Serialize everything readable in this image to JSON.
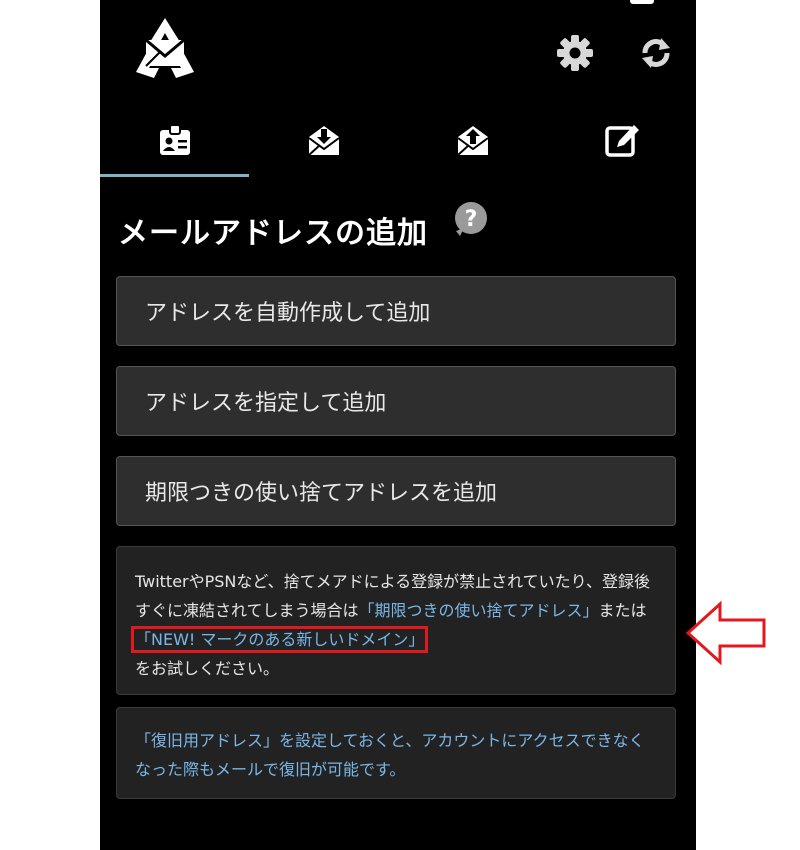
{
  "colors": {
    "background": "#000000",
    "button_bg": "#2e2e2e",
    "card_bg": "#222222",
    "link": "#7ab6e8",
    "tab_indicator": "#7fb4c2",
    "highlight": "#e0191f"
  },
  "header": {
    "logo_icon": "recycle-mail-logo",
    "icons": [
      "gear-icon",
      "refresh-icon"
    ]
  },
  "tabs": [
    {
      "icon": "contact-card-icon",
      "active": true
    },
    {
      "icon": "inbox-download-icon",
      "active": false
    },
    {
      "icon": "outbox-upload-icon",
      "active": false
    },
    {
      "icon": "compose-icon",
      "active": false
    }
  ],
  "page": {
    "title": "メールアドレスの追加"
  },
  "buttons": {
    "auto": "アドレスを自動作成して追加",
    "specify": "アドレスを指定して追加",
    "disposable": "期限つきの使い捨てアドレスを追加"
  },
  "notice": {
    "text1": "TwitterやPSNなど、捨てメアドによる登録が禁止されていたり、登録後すぐに凍結されてしまう場合は",
    "link1": "「期限つきの使い捨てアドレス」",
    "text2": "または",
    "link2": "「NEW! マークのある新しいドメイン」",
    "text3": "をお試しください。"
  },
  "recovery": {
    "link": "「復旧用アドレス」を設定しておくと、アカウントにアクセスできなくなった際もメールで復旧が可能です。"
  }
}
